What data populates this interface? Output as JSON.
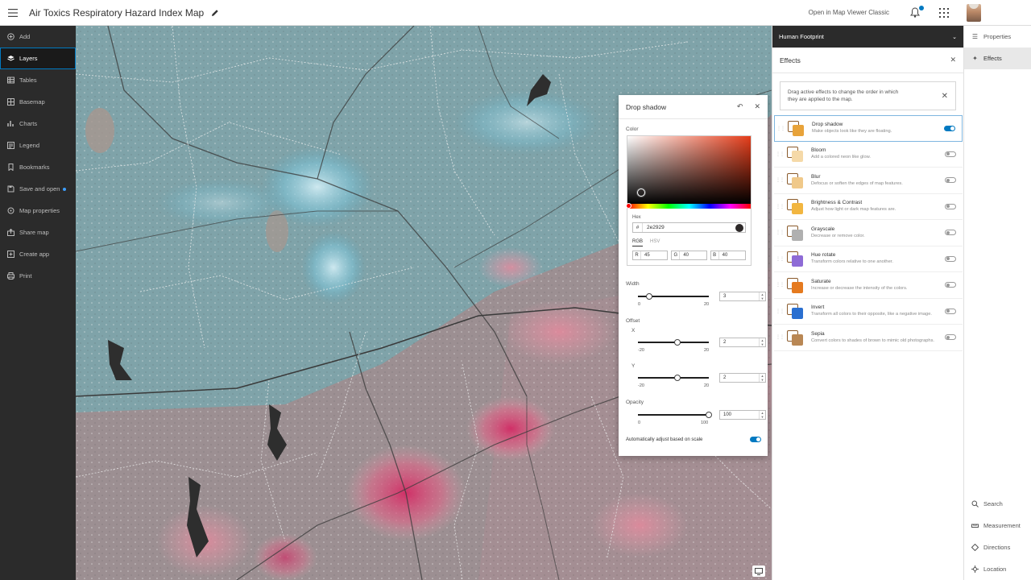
{
  "header": {
    "title": "Air Toxics Respiratory Hazard Index Map",
    "open_classic": "Open in Map Viewer Classic"
  },
  "left_nav": {
    "items": [
      {
        "label": "Add",
        "icon": "plus-circle-icon"
      },
      {
        "label": "Layers",
        "icon": "layers-icon",
        "active": true
      },
      {
        "label": "Tables",
        "icon": "table-icon"
      },
      {
        "label": "Basemap",
        "icon": "basemap-icon"
      },
      {
        "label": "Charts",
        "icon": "chart-icon"
      },
      {
        "label": "Legend",
        "icon": "legend-icon"
      },
      {
        "label": "Bookmarks",
        "icon": "bookmark-icon"
      },
      {
        "label": "Save and open",
        "icon": "save-icon"
      },
      {
        "label": "Map properties",
        "icon": "map-properties-icon"
      },
      {
        "label": "Share map",
        "icon": "share-icon"
      },
      {
        "label": "Create app",
        "icon": "create-app-icon"
      },
      {
        "label": "Print",
        "icon": "print-icon"
      }
    ]
  },
  "drop_shadow": {
    "title": "Drop shadow",
    "color_label": "Color",
    "hex_label": "Hex",
    "hash": "#",
    "hex_value": "2e2929",
    "mode_rgb": "RGB",
    "mode_hsv": "HSV",
    "r_label": "R",
    "r_value": "45",
    "g_label": "G",
    "g_value": "40",
    "b_label": "B",
    "b_value": "40",
    "width_label": "Width",
    "width_min": "0",
    "width_max": "20",
    "width_value": "3",
    "offset_label": "Offset",
    "x_label": "X",
    "x_min": "-20",
    "x_max": "20",
    "x_value": "2",
    "y_label": "Y",
    "y_min": "-20",
    "y_max": "20",
    "y_value": "2",
    "opacity_label": "Opacity",
    "opacity_min": "0",
    "opacity_max": "100",
    "opacity_value": "100",
    "auto_adjust_label": "Automatically adjust based on scale",
    "auto_adjust_on": true
  },
  "effects_panel": {
    "layer_name": "Human Footprint",
    "title": "Effects",
    "notice": "Drag active effects to change the order in which they are applied to the map.",
    "effects": [
      {
        "name": "Drop shadow",
        "desc": "Make objects look like they are floating.",
        "on": true,
        "color": "#e8a33a"
      },
      {
        "name": "Bloom",
        "desc": "Add a colored neon like glow.",
        "on": false,
        "color": "#f5d9a8"
      },
      {
        "name": "Blur",
        "desc": "Defocus or soften the edges of map features.",
        "on": false,
        "color": "#f0c98a"
      },
      {
        "name": "Brightness & Contrast",
        "desc": "Adjust how light or dark map features are.",
        "on": false,
        "color": "#f2b640"
      },
      {
        "name": "Grayscale",
        "desc": "Decrease or remove color.",
        "on": false,
        "color": "#b0b0b0"
      },
      {
        "name": "Hue rotate",
        "desc": "Transform colors relative to one another.",
        "on": false,
        "color": "#8e6bd6"
      },
      {
        "name": "Saturate",
        "desc": "Increase or decrease the intensity of the colors.",
        "on": false,
        "color": "#e57a1f"
      },
      {
        "name": "Invert",
        "desc": "Transform all colors to their opposite, like a negative image.",
        "on": false,
        "color": "#2a6fd0"
      },
      {
        "name": "Sepia",
        "desc": "Convert colors to shades of brown to mimic old photographs.",
        "on": false,
        "color": "#b98754"
      }
    ]
  },
  "right_rail": {
    "top": [
      {
        "label": "Properties",
        "icon": "properties-icon"
      },
      {
        "label": "Effects",
        "icon": "effects-icon",
        "active": true
      }
    ],
    "bottom": [
      {
        "label": "Search",
        "icon": "search-icon"
      },
      {
        "label": "Measurement",
        "icon": "measurement-icon"
      },
      {
        "label": "Directions",
        "icon": "directions-icon"
      },
      {
        "label": "Location",
        "icon": "location-icon"
      }
    ]
  }
}
